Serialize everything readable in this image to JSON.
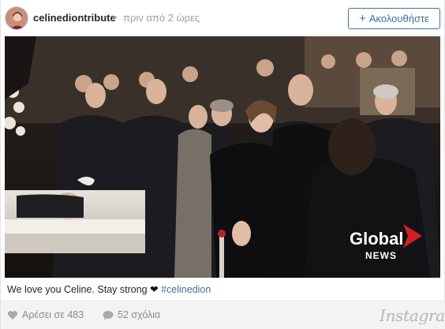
{
  "post": {
    "username": "celinediontribute",
    "separator": "•",
    "time": "πριν από 2 ώρες",
    "follow_label": "Ακολουθήστε",
    "follow_icon": "plus-icon"
  },
  "photo": {
    "watermark_line1": "Global",
    "watermark_line2": "NEWS",
    "brand_color": "#d21f26"
  },
  "caption": {
    "text": "We love you Celine. Stay strong",
    "heart": "❤",
    "hashtag": "#celinedion"
  },
  "footer": {
    "likes_label": "Αρέσει σε 483",
    "comments_label": "52 σχόλια",
    "logo": "Instagram"
  },
  "colors": {
    "link": "#3f729b",
    "muted": "#8c8c8c"
  }
}
